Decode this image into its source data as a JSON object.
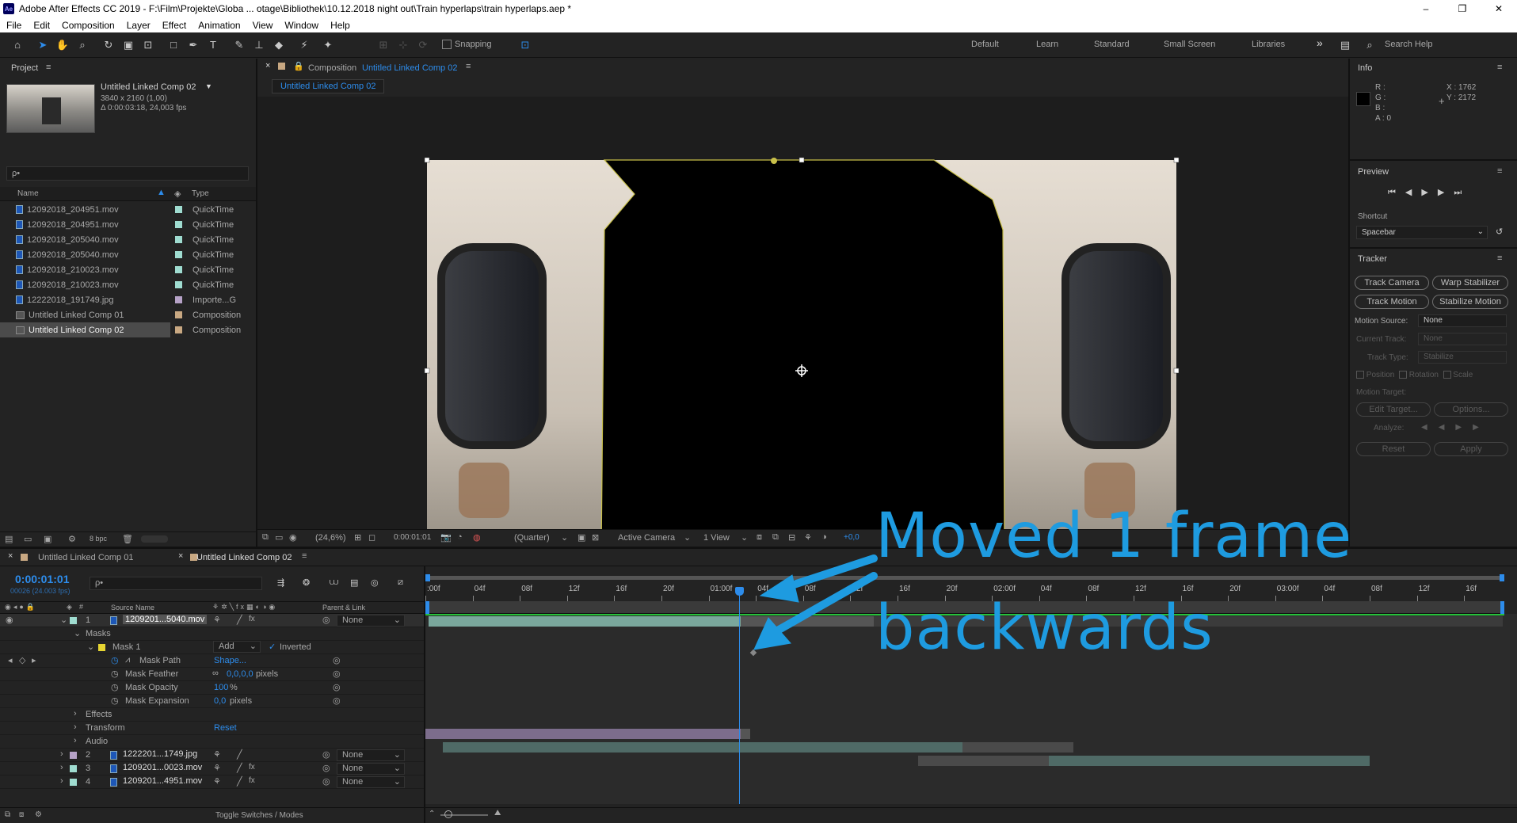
{
  "titlebar": {
    "text": "Adobe After Effects CC 2019 - F:\\Film\\Projekte\\Globa ... otage\\Bibliothek\\10.12.2018 night out\\Train hyperlaps\\train hyperlaps.aep *",
    "minimize": "–",
    "maximize": "❐",
    "close": "✕"
  },
  "menu": [
    "File",
    "Edit",
    "Composition",
    "Layer",
    "Effect",
    "Animation",
    "View",
    "Window",
    "Help"
  ],
  "toolbar": {
    "snapping": "Snapping",
    "workspaces": [
      "Default",
      "Learn",
      "Standard",
      "Small Screen",
      "Libraries"
    ],
    "overflow": "»",
    "search_help": "Search Help"
  },
  "project": {
    "title": "Project",
    "comp_name": "Untitled Linked Comp 02",
    "comp_res": "3840 x 2160 (1,00)",
    "comp_dur": "Δ 0:00:03:18, 24,003 fps",
    "search_placeholder": "ρ•",
    "col_name": "Name",
    "col_type": "Type",
    "items": [
      {
        "name": "12092018_204951.mov",
        "type": "QuickTime",
        "color": "#9fdcd0"
      },
      {
        "name": "12092018_204951.mov",
        "type": "QuickTime",
        "color": "#9fdcd0"
      },
      {
        "name": "12092018_205040.mov",
        "type": "QuickTime",
        "color": "#9fdcd0"
      },
      {
        "name": "12092018_205040.mov",
        "type": "QuickTime",
        "color": "#9fdcd0"
      },
      {
        "name": "12092018_210023.mov",
        "type": "QuickTime",
        "color": "#9fdcd0"
      },
      {
        "name": "12092018_210023.mov",
        "type": "QuickTime",
        "color": "#9fdcd0"
      },
      {
        "name": "12222018_191749.jpg",
        "type": "Importe...G",
        "color": "#b6a2c7"
      },
      {
        "name": "Untitled Linked Comp 01",
        "type": "Composition",
        "color": "#c8a882"
      },
      {
        "name": "Untitled Linked Comp 02",
        "type": "Composition",
        "color": "#c8a882"
      }
    ],
    "bpc": "8 bpc"
  },
  "composition": {
    "tab_label": "Composition",
    "tab_comp": "Untitled Linked Comp 02",
    "breadcrumb": "Untitled Linked Comp 02",
    "zoom": "(24,6%)",
    "timecode": "0:00:01:01",
    "resolution": "(Quarter)",
    "camera": "Active Camera",
    "views": "1 View",
    "exposure": "+0,0"
  },
  "info": {
    "title": "Info",
    "r": "R :",
    "g": "G :",
    "b": "B :",
    "a": "A :  0",
    "x": "X : 1762",
    "y": "Y : 2172"
  },
  "preview": {
    "title": "Preview",
    "shortcut_label": "Shortcut",
    "shortcut_value": "Spacebar"
  },
  "tracker": {
    "title": "Tracker",
    "track_camera": "Track Camera",
    "warp_stabilizer": "Warp Stabilizer",
    "track_motion": "Track Motion",
    "stabilize_motion": "Stabilize Motion",
    "motion_source_label": "Motion Source:",
    "motion_source_value": "None",
    "current_track_label": "Current Track:",
    "current_track_value": "None",
    "track_type_label": "Track Type:",
    "track_type_value": "Stabilize",
    "position": "Position",
    "rotation": "Rotation",
    "scale": "Scale",
    "motion_target": "Motion Target:",
    "edit_target": "Edit Target...",
    "options": "Options...",
    "analyze": "Analyze:",
    "reset": "Reset",
    "apply": "Apply"
  },
  "timeline": {
    "tabs": [
      "Untitled Linked Comp 01",
      "Untitled Linked Comp 02"
    ],
    "timecode": "0:00:01:01",
    "frames": "00026 (24.003 fps)",
    "col_source": "Source Name",
    "col_parent": "Parent & Link",
    "ruler": [
      ":00f",
      "04f",
      "08f",
      "12f",
      "16f",
      "20f",
      "01:00f",
      "04f",
      "08f",
      "12f",
      "16f",
      "20f",
      "02:00f",
      "04f",
      "08f",
      "12f",
      "16f",
      "20f",
      "03:00f",
      "04f",
      "08f",
      "12f",
      "16f"
    ],
    "layers": [
      {
        "num": "1",
        "name": "1209201...5040.mov",
        "parent": "None",
        "color": "#9fdcd0"
      },
      {
        "num": "2",
        "name": "1222201...1749.jpg",
        "parent": "None",
        "color": "#b6a2c7"
      },
      {
        "num": "3",
        "name": "1209201...0023.mov",
        "parent": "None",
        "color": "#9fdcd0"
      },
      {
        "num": "4",
        "name": "1209201...4951.mov",
        "parent": "None",
        "color": "#9fdcd0"
      }
    ],
    "masks": "Masks",
    "mask1": "Mask 1",
    "mask_mode": "Add",
    "inverted": "Inverted",
    "mask_path": "Mask Path",
    "mask_path_val": "Shape...",
    "mask_feather": "Mask Feather",
    "mask_feather_val": "0,0,0,0",
    "mask_feather_unit": "pixels",
    "mask_opacity": "Mask Opacity",
    "mask_opacity_val": "100",
    "mask_opacity_unit": "%",
    "mask_expansion": "Mask Expansion",
    "mask_expansion_val": "0,0",
    "mask_expansion_unit": "pixels",
    "effects": "Effects",
    "transform": "Transform",
    "transform_reset": "Reset",
    "audio": "Audio",
    "toggle": "Toggle Switches / Modes"
  },
  "annotation": {
    "line1": "Moved 1 frame",
    "line2": "backwards",
    "color": "#1e9be0"
  }
}
